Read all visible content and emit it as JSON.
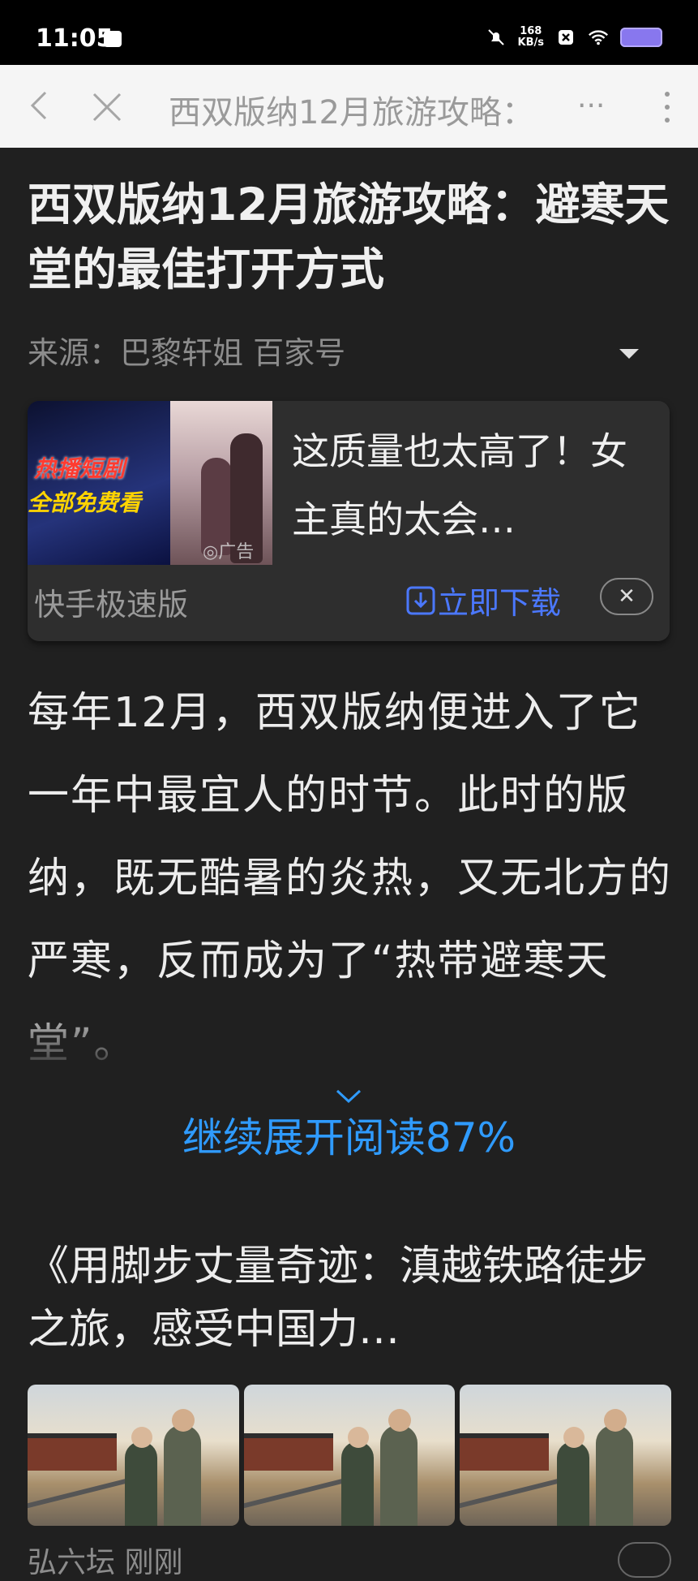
{
  "status_bar": {
    "time": "11:05",
    "speed_value": "168",
    "speed_unit": "KB/s"
  },
  "top_bar": {
    "title": "西双版纳12月旅游攻略：",
    "more": "···"
  },
  "article": {
    "headline": "西双版纳12月旅游攻略：避寒天堂的最佳打开方式",
    "source": "来源：巴黎轩姐 百家号"
  },
  "ad": {
    "image_tag_line1": "热播短剧",
    "image_tag_line2": "全部免费看",
    "ad_mark": "◎广告",
    "text": "这质量也太高了！女主真的太会…",
    "app_name": "快手极速版",
    "download_label": "立即下载",
    "close_label": "✕"
  },
  "body": {
    "paragraph": "每年12月，西双版纳便进入了它一年中最宜人的时节。此时的版纳，既无酷暑的炎热，又无北方的严寒，反而成为了“热带避寒天堂”。",
    "expand_label": "继续展开阅读87%"
  },
  "related": {
    "title": "《用脚步丈量奇迹：滇越铁路徒步之旅，感受中国力…",
    "bottom_fragment": "弘六坛 刚刚"
  },
  "colors": {
    "accent_blue": "#2f9bff",
    "download_blue": "#4b78ff",
    "background": "#202020"
  }
}
